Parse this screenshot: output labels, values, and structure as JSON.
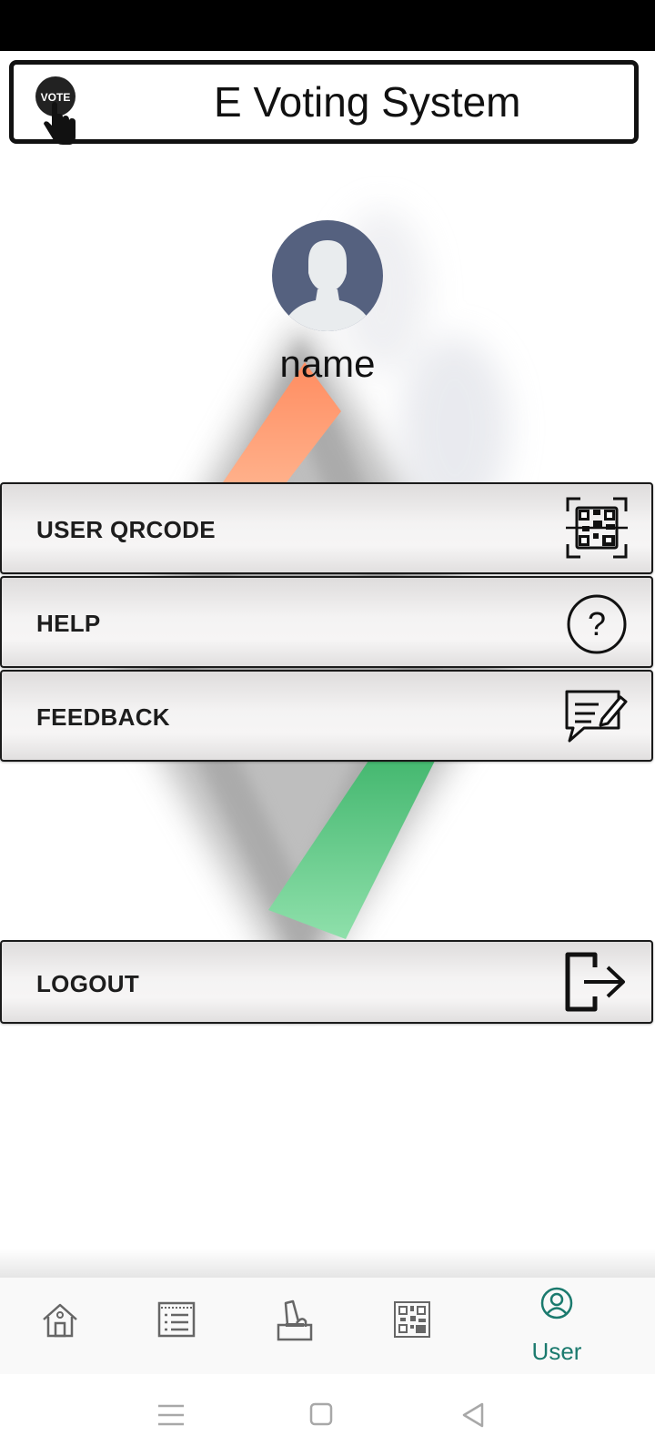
{
  "header": {
    "title": "E Voting System",
    "logo_text": "VOTE"
  },
  "profile": {
    "name": "name"
  },
  "menu": {
    "qrcode_label": "USER QRCODE",
    "help_label": "HELP",
    "feedback_label": "FEEDBACK",
    "logout_label": "LOGOUT",
    "help_icon_glyph": "?"
  },
  "bottom_nav": {
    "items": [
      {
        "icon": "home-icon"
      },
      {
        "icon": "list-icon"
      },
      {
        "icon": "ballot-box-icon"
      },
      {
        "icon": "qrcode-icon"
      },
      {
        "icon": "user-icon",
        "label": "User",
        "active": true
      }
    ]
  },
  "colors": {
    "accent": "#1b7a6e",
    "avatar_bg": "#55617f",
    "saffron": "#ff9a6a",
    "green": "#5cc785"
  }
}
